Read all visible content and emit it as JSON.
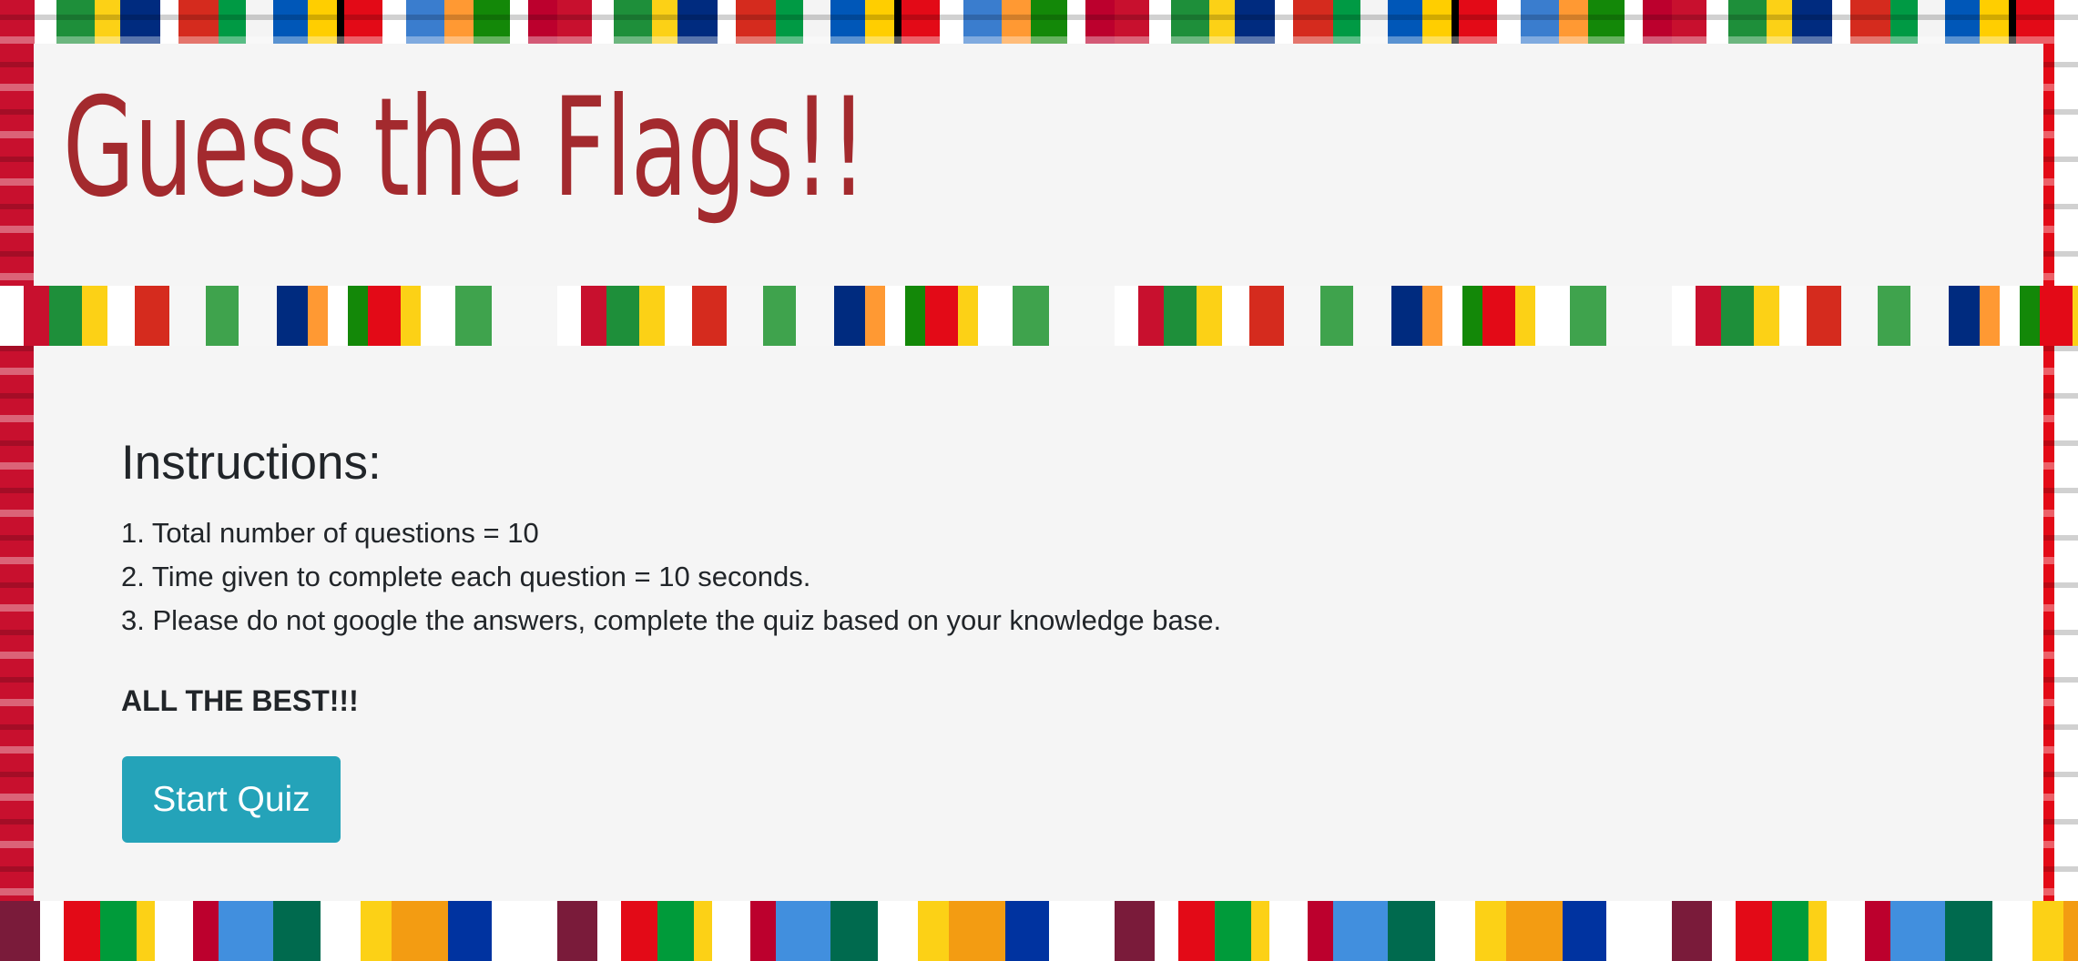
{
  "header": {
    "title": "Guess the Flags!!"
  },
  "instructions": {
    "heading": "Instructions:",
    "items": [
      "1. Total number of questions = 10",
      "2. Time given to complete each question = 10 seconds.",
      "3. Please do not google the answers, complete the quiz based on your knowledge base."
    ],
    "closing": "ALL THE BEST!!!"
  },
  "actions": {
    "start_label": "Start Quiz"
  },
  "colors": {
    "title": "#a32a2e",
    "panel": "#f5f5f5",
    "button": "#24a3b9",
    "text": "#212529"
  }
}
